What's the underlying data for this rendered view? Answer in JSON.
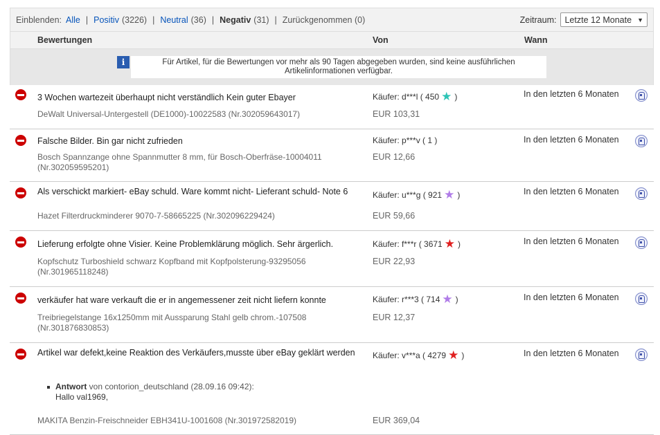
{
  "filter": {
    "label": "Einblenden:",
    "all": "Alle",
    "positive_label": "Positiv",
    "positive_count": "(3226)",
    "neutral_label": "Neutral",
    "neutral_count": "(36)",
    "negative_label": "Negativ",
    "negative_count": "(31)",
    "withdrawn": "Zurückgenommen (0)",
    "separator": "|",
    "period_label": "Zeitraum:",
    "period_value": "Letzte 12 Monate",
    "period_arrow": "▼"
  },
  "columns": {
    "feedback": "Bewertungen",
    "from": "Von",
    "when": "Wann"
  },
  "info": {
    "icon": "i",
    "text": "Für Artikel, für die Bewertungen vor mehr als 90 Tagen abgegeben wurden, sind keine ausführlichen Artikelinformationen verfügbar."
  },
  "rows": [
    {
      "comment": "3 Wochen wartezeit überhaupt nicht verständlich Kein guter Ebayer",
      "buyer": "Käufer: d***l ( 450",
      "buyer_close": ")",
      "star_color": "#2ec4b6",
      "item": "DeWalt Universal-Untergestell (DE1000)-10022583 (Nr.302059643017)",
      "price": "EUR 103,31",
      "when": "In den letzten 6 Monaten"
    },
    {
      "comment": "Falsche Bilder. Bin gar nicht zufrieden",
      "buyer": "Käufer: p***v ( 1 )",
      "buyer_close": "",
      "star_color": "",
      "item": "Bosch Spannzange ohne Spannmutter 8 mm, für Bosch-Oberfräse-10004011 (Nr.302059595201)",
      "price": "EUR 12,66",
      "when": "In den letzten 6 Monaten"
    },
    {
      "comment": "Als verschickt markiert- eBay schuld. Ware kommt nicht- Lieferant schuld- Note 6",
      "buyer": "Käufer: u***g ( 921",
      "buyer_close": ")",
      "star_color": "#b07ce8",
      "item": "Hazet Filterdruckminderer 9070-7-58665225 (Nr.302096229424)",
      "price": "EUR 59,66",
      "when": "In den letzten 6 Monaten"
    },
    {
      "comment": "Lieferung erfolgte ohne Visier. Keine Problemklärung möglich. Sehr ärgerlich.",
      "buyer": "Käufer: f***r ( 3671",
      "buyer_close": ")",
      "star_color": "#e02020",
      "item": "Kopfschutz Turboshield schwarz Kopfband mit Kopfpolsterung-93295056 (Nr.301965118248)",
      "price": "EUR 22,93",
      "when": "In den letzten 6 Monaten"
    },
    {
      "comment": "verkäufer hat ware verkauft die er in angemessener zeit nicht liefern konnte",
      "buyer": "Käufer: r***3 ( 714",
      "buyer_close": ")",
      "star_color": "#b07ce8",
      "item": "Treibriegelstange 16x1250mm mit Aussparung Stahl gelb chrom.-107508 (Nr.301876830853)",
      "price": "EUR 12,37",
      "when": "In den letzten 6 Monaten"
    },
    {
      "comment": "Artikel war defekt,keine Reaktion des Verkäufers,musste über eBay geklärt werden",
      "buyer": "Käufer: v***a ( 4279",
      "buyer_close": ")",
      "star_color": "#e02020",
      "item": "MAKITA Benzin-Freischneider EBH341U-1001608 (Nr.301972582019)",
      "price": "EUR 369,04",
      "when": "In den letzten 6 Monaten",
      "reply_label": "Antwort",
      "reply_by": "von contorion_deutschland (28.09.16 09:42):",
      "reply_text": "Hallo val1969,"
    }
  ]
}
